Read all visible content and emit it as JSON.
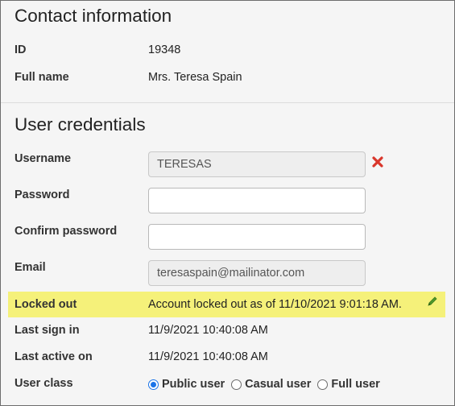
{
  "contact": {
    "title": "Contact information",
    "id_label": "ID",
    "id_value": "19348",
    "fullname_label": "Full name",
    "fullname_value": "Mrs. Teresa Spain"
  },
  "credentials": {
    "title": "User credentials",
    "username_label": "Username",
    "username_value": "TERESAS",
    "password_label": "Password",
    "password_value": "",
    "confirm_label": "Confirm password",
    "confirm_value": "",
    "email_label": "Email",
    "email_value": "teresaspain@mailinator.com",
    "locked_label": "Locked out",
    "locked_value": "Account locked out as of 11/10/2021 9:01:18 AM.",
    "last_signin_label": "Last sign in",
    "last_signin_value": "11/9/2021 10:40:08 AM",
    "last_active_label": "Last active on",
    "last_active_value": "11/9/2021 10:40:08 AM",
    "user_class_label": "User class",
    "user_class_options": [
      "Public user",
      "Casual user",
      "Full user"
    ],
    "user_class_selected": "Public user"
  },
  "icons": {
    "clear": "clear-x-icon",
    "edit": "pencil-icon"
  },
  "colors": {
    "highlight": "#f5f17a",
    "clear_icon": "#d9362b",
    "edit_icon": "#4f9a2b",
    "radio_selected": "#1a73e8"
  }
}
